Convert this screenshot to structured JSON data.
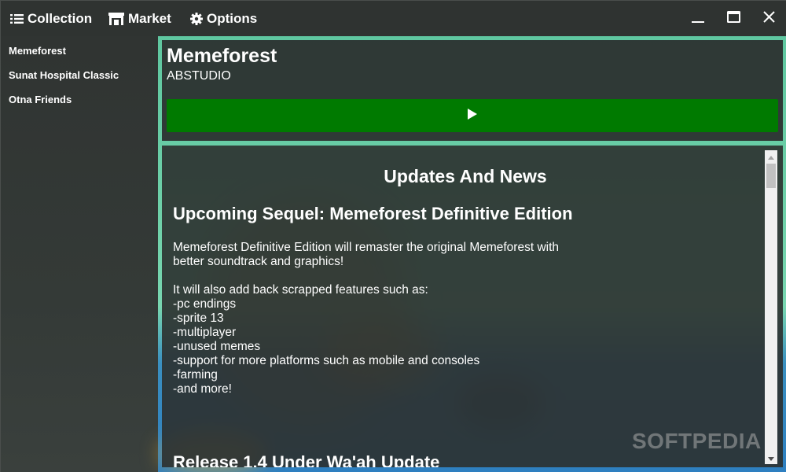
{
  "nav": {
    "collection": "Collection",
    "market": "Market",
    "options": "Options"
  },
  "sidebar": {
    "items": [
      {
        "label": "Memeforest"
      },
      {
        "label": "Sunat Hospital Classic"
      },
      {
        "label": "Otna Friends"
      }
    ]
  },
  "game": {
    "title": "Memeforest",
    "developer": "ABSTUDIO",
    "play_icon": "play-icon",
    "play_color": "#007a00"
  },
  "news": {
    "heading": "Updates And News",
    "post_title": "Upcoming Sequel: Memeforest Definitive Edition",
    "body_line1": "Memeforest Definitive Edition will remaster the original Memeforest with",
    "body_line2": "better soundtrack and graphics!",
    "features_intro": "It will also add back scrapped features such as:",
    "features": [
      "-pc endings",
      "-sprite 13",
      "-multiplayer",
      "-unused memes",
      "-support for more platforms such as mobile and consoles",
      "-farming",
      "-and more!"
    ],
    "next_post_title": "Release 1.4 Under Wa'ah Update"
  },
  "watermark": "SOFTPEDIA",
  "colors": {
    "accent_border": "#5fc7a0",
    "background": "#303432"
  }
}
